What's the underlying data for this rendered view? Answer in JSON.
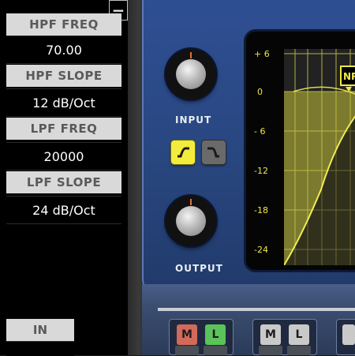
{
  "panel": {
    "collapse_symbol": "−",
    "params": [
      {
        "label": "HPF FREQ",
        "value": "70.00"
      },
      {
        "label": "HPF SLOPE",
        "value": "12 dB/Oct"
      },
      {
        "label": "LPF FREQ",
        "value": "20000"
      },
      {
        "label": "LPF SLOPE",
        "value": "24 dB/Oct"
      }
    ],
    "in_label": "IN"
  },
  "device": {
    "input_label": "INPUT",
    "output_label": "OUTPUT",
    "filter_buttons": [
      {
        "name": "high-pass-shape",
        "active": true
      },
      {
        "name": "low-pass-shape",
        "active": false
      }
    ],
    "display": {
      "y_ticks": [
        "+ 6",
        "0",
        "- 6",
        "-12",
        "-18",
        "-24"
      ],
      "marker_label": "NR"
    },
    "ml_buttons": [
      {
        "m": "M",
        "l": "L",
        "colored": true
      },
      {
        "m": "M",
        "l": "L",
        "colored": false
      }
    ]
  },
  "colors": {
    "accent_yellow": "#f4ec3c",
    "device_blue": "#2f4f93",
    "label_gray": "#d9d9d9",
    "m_red": "#d16a5a",
    "l_green": "#5bc35a"
  }
}
